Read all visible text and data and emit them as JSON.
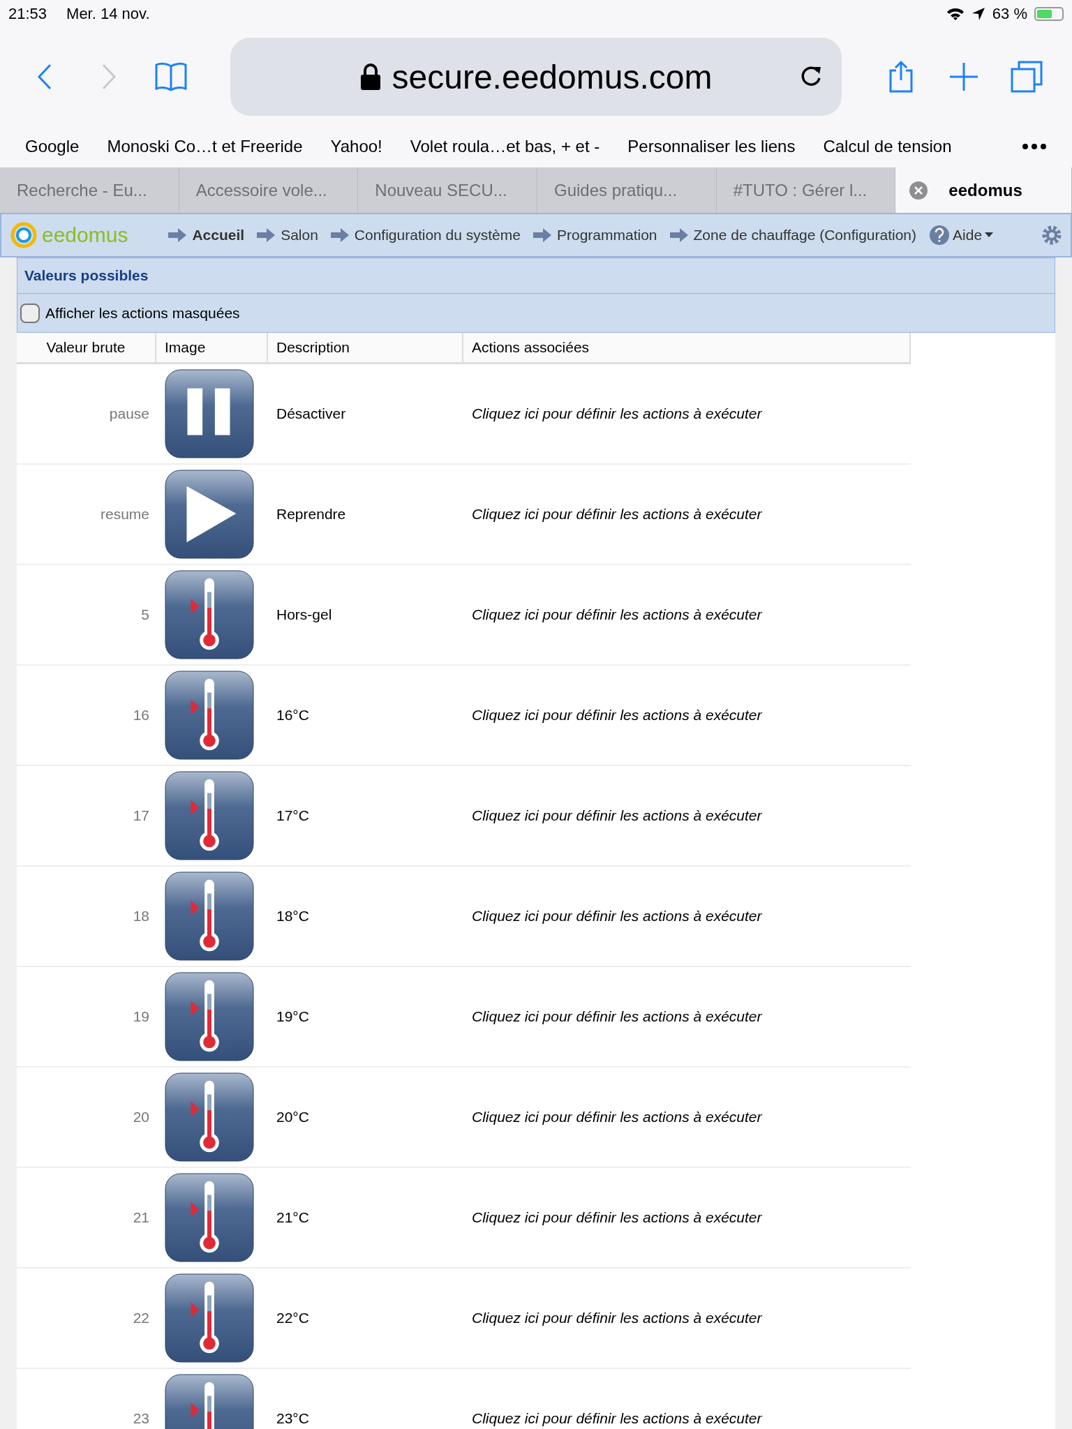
{
  "status_bar": {
    "time": "21:53",
    "date": "Mer. 14 nov.",
    "battery": "63 %"
  },
  "address_bar": {
    "url": "secure.eedomus.com"
  },
  "bookmarks": [
    "Google",
    "Monoski Co…t et Freeride",
    "Yahoo!",
    "Volet roula…et bas, + et -",
    "Personnaliser les liens",
    "Calcul de tension"
  ],
  "tabs": [
    {
      "label": "Recherche - Eu...",
      "selected": false
    },
    {
      "label": "Accessoire vole...",
      "selected": false
    },
    {
      "label": "Nouveau SECU...",
      "selected": false
    },
    {
      "label": "Guides pratiqu...",
      "selected": false
    },
    {
      "label": "#TUTO : Gérer l...",
      "selected": false
    },
    {
      "label": "eedomus",
      "selected": true
    }
  ],
  "app_nav": {
    "logo": "eedomus",
    "breadcrumbs": [
      {
        "label": "Accueil",
        "selected": true
      },
      {
        "label": "Salon",
        "selected": false
      },
      {
        "label": "Configuration du système",
        "selected": false
      },
      {
        "label": "Programmation",
        "selected": false
      },
      {
        "label": "Zone de chauffage (Configuration)",
        "selected": false
      }
    ],
    "help": "Aide"
  },
  "panel": {
    "title": "Valeurs possibles",
    "show_hidden": {
      "label": "Afficher les actions masquées",
      "checked": false
    }
  },
  "table": {
    "columns": [
      "Valeur brute",
      "Image",
      "Description",
      "Actions associées"
    ],
    "rows": [
      {
        "value": "pause",
        "kind": "pause",
        "description": "Désactiver",
        "actions": "Cliquez ici pour définir les actions à exécuter"
      },
      {
        "value": "resume",
        "kind": "play",
        "description": "Reprendre",
        "actions": "Cliquez ici pour définir les actions à exécuter"
      },
      {
        "value": "5",
        "kind": "thermometer",
        "description": "Hors-gel",
        "actions": "Cliquez ici pour définir les actions à exécuter"
      },
      {
        "value": "16",
        "kind": "thermometer",
        "description": "16°C",
        "actions": "Cliquez ici pour définir les actions à exécuter"
      },
      {
        "value": "17",
        "kind": "thermometer",
        "description": "17°C",
        "actions": "Cliquez ici pour définir les actions à exécuter"
      },
      {
        "value": "18",
        "kind": "thermometer",
        "description": "18°C",
        "actions": "Cliquez ici pour définir les actions à exécuter"
      },
      {
        "value": "19",
        "kind": "thermometer",
        "description": "19°C",
        "actions": "Cliquez ici pour définir les actions à exécuter"
      },
      {
        "value": "20",
        "kind": "thermometer",
        "description": "20°C",
        "actions": "Cliquez ici pour définir les actions à exécuter"
      },
      {
        "value": "21",
        "kind": "thermometer",
        "description": "21°C",
        "actions": "Cliquez ici pour définir les actions à exécuter"
      },
      {
        "value": "22",
        "kind": "thermometer",
        "description": "22°C",
        "actions": "Cliquez ici pour définir les actions à exécuter"
      },
      {
        "value": "23",
        "kind": "thermometer",
        "description": "23°C",
        "actions": "Cliquez ici pour définir les actions à exécuter"
      }
    ]
  }
}
